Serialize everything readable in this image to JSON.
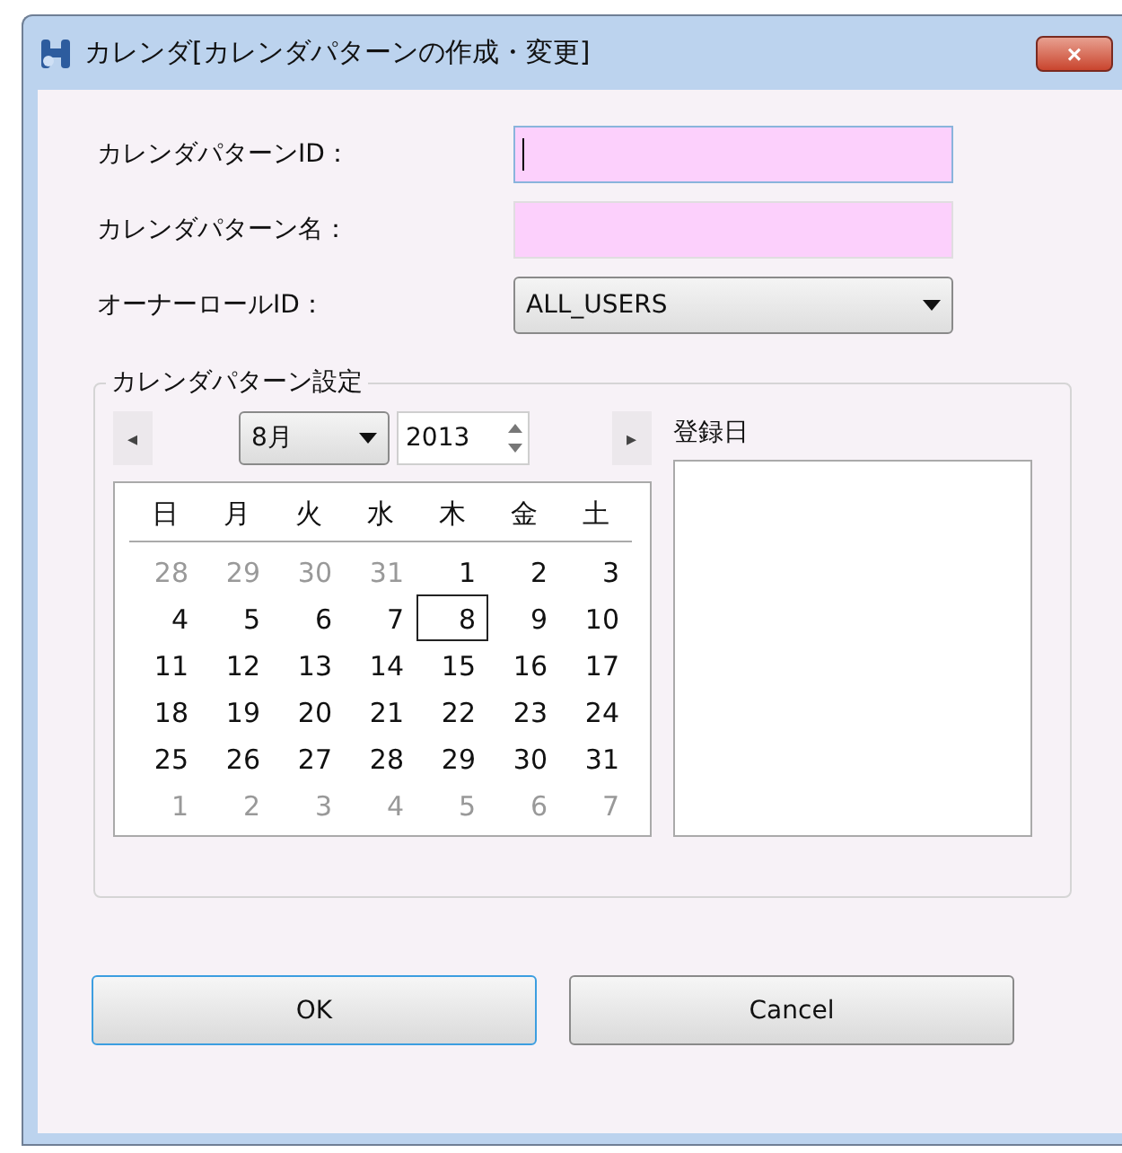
{
  "window": {
    "title": "カレンダ[カレンダパターンの作成・変更]",
    "close": "×"
  },
  "fields": [
    {
      "kind": "text",
      "label": "カレンダパターンID：",
      "focused": true
    },
    {
      "kind": "text",
      "label": "カレンダパターン名：",
      "focused": false
    },
    {
      "kind": "select",
      "label": "オーナーロールID：",
      "value": "ALL_USERS",
      "focused": false
    }
  ],
  "group": {
    "title": "カレンダパターン設定"
  },
  "calendar": {
    "prev": "◂",
    "next": "▸",
    "month": "8月",
    "year": "2013",
    "weekdays": [
      "日",
      "月",
      "火",
      "水",
      "木",
      "金",
      "土"
    ],
    "weeks": [
      [
        {
          "text": "28",
          "other": true,
          "selected": false
        },
        {
          "text": "29",
          "other": true,
          "selected": false
        },
        {
          "text": "30",
          "other": true,
          "selected": false
        },
        {
          "text": "31",
          "other": true,
          "selected": false
        },
        {
          "text": "1",
          "other": false,
          "selected": false
        },
        {
          "text": "2",
          "other": false,
          "selected": false
        },
        {
          "text": "3",
          "other": false,
          "selected": false
        }
      ],
      [
        {
          "text": "4",
          "other": false,
          "selected": false
        },
        {
          "text": "5",
          "other": false,
          "selected": false
        },
        {
          "text": "6",
          "other": false,
          "selected": false
        },
        {
          "text": "7",
          "other": false,
          "selected": false
        },
        {
          "text": "8",
          "other": false,
          "selected": true
        },
        {
          "text": "9",
          "other": false,
          "selected": false
        },
        {
          "text": "10",
          "other": false,
          "selected": false
        }
      ],
      [
        {
          "text": "11",
          "other": false,
          "selected": false
        },
        {
          "text": "12",
          "other": false,
          "selected": false
        },
        {
          "text": "13",
          "other": false,
          "selected": false
        },
        {
          "text": "14",
          "other": false,
          "selected": false
        },
        {
          "text": "15",
          "other": false,
          "selected": false
        },
        {
          "text": "16",
          "other": false,
          "selected": false
        },
        {
          "text": "17",
          "other": false,
          "selected": false
        }
      ],
      [
        {
          "text": "18",
          "other": false,
          "selected": false
        },
        {
          "text": "19",
          "other": false,
          "selected": false
        },
        {
          "text": "20",
          "other": false,
          "selected": false
        },
        {
          "text": "21",
          "other": false,
          "selected": false
        },
        {
          "text": "22",
          "other": false,
          "selected": false
        },
        {
          "text": "23",
          "other": false,
          "selected": false
        },
        {
          "text": "24",
          "other": false,
          "selected": false
        }
      ],
      [
        {
          "text": "25",
          "other": false,
          "selected": false
        },
        {
          "text": "26",
          "other": false,
          "selected": false
        },
        {
          "text": "27",
          "other": false,
          "selected": false
        },
        {
          "text": "28",
          "other": false,
          "selected": false
        },
        {
          "text": "29",
          "other": false,
          "selected": false
        },
        {
          "text": "30",
          "other": false,
          "selected": false
        },
        {
          "text": "31",
          "other": false,
          "selected": false
        }
      ],
      [
        {
          "text": "1",
          "other": true,
          "selected": false
        },
        {
          "text": "2",
          "other": true,
          "selected": false
        },
        {
          "text": "3",
          "other": true,
          "selected": false
        },
        {
          "text": "4",
          "other": true,
          "selected": false
        },
        {
          "text": "5",
          "other": true,
          "selected": false
        },
        {
          "text": "6",
          "other": true,
          "selected": false
        },
        {
          "text": "7",
          "other": true,
          "selected": false
        }
      ]
    ]
  },
  "registered": {
    "label": "登録日"
  },
  "buttons": [
    {
      "label": "OK",
      "focused": true
    },
    {
      "label": "Cancel",
      "focused": false
    }
  ]
}
